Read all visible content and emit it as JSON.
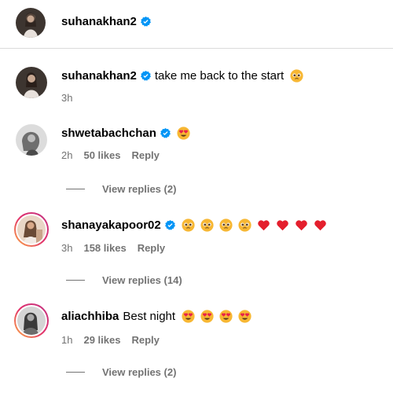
{
  "header": {
    "username": "suhanakhan2"
  },
  "comments": [
    {
      "username": "suhanakhan2",
      "text": "take me back to the start",
      "emojis": [
        "pleading"
      ],
      "time": "3h",
      "likes": "",
      "reply": "",
      "view_replies": ""
    },
    {
      "username": "shwetabachchan",
      "text": "",
      "emojis": [
        "heart-eyes"
      ],
      "time": "2h",
      "likes": "50 likes",
      "reply": "Reply",
      "view_replies": "View replies (2)"
    },
    {
      "username": "shanayakapoor02",
      "text": "",
      "emojis": [
        "pleading",
        "pleading",
        "pleading",
        "pleading",
        "red-heart",
        "red-heart",
        "red-heart",
        "red-heart"
      ],
      "time": "3h",
      "likes": "158 likes",
      "reply": "Reply",
      "view_replies": "View replies (14)"
    },
    {
      "username": "aliachhiba",
      "text": "Best night",
      "emojis": [
        "heart-eyes",
        "heart-eyes",
        "heart-eyes",
        "heart-eyes"
      ],
      "time": "1h",
      "likes": "29 likes",
      "reply": "Reply",
      "view_replies": "View replies (2)"
    }
  ],
  "colors": {
    "verified": "#0095f6",
    "meta": "#737373",
    "story_ring_start": "#fcaf45",
    "story_ring_end": "#c13584"
  },
  "icons": {
    "verified": "verified-badge-icon"
  }
}
